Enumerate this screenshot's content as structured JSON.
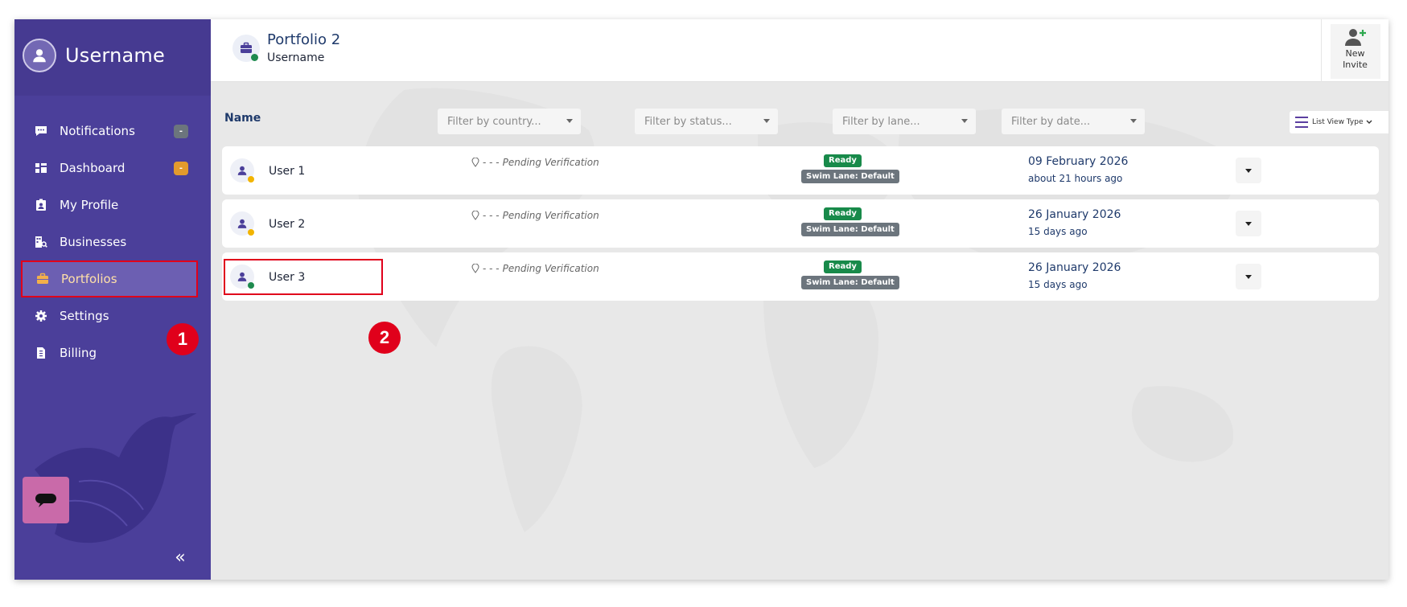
{
  "sidebar": {
    "username": "Username",
    "items": [
      {
        "label": "Notifications",
        "icon": "comment-dots-icon",
        "badge": "-",
        "badge_color": "#6c757d"
      },
      {
        "label": "Dashboard",
        "icon": "dashboard-icon",
        "badge": "-",
        "badge_color": "#e39a2d"
      },
      {
        "label": "My Profile",
        "icon": "id-badge-icon"
      },
      {
        "label": "Businesses",
        "icon": "building-search-icon"
      },
      {
        "label": "Portfolios",
        "icon": "briefcase-icon",
        "active": true
      },
      {
        "label": "Settings",
        "icon": "gear-icon"
      },
      {
        "label": "Billing",
        "icon": "invoice-icon"
      }
    ],
    "collapse_glyph": "«"
  },
  "header": {
    "title": "Portfolio 2",
    "subtitle": "Username",
    "new_invite_line1": "New",
    "new_invite_line2": "Invite"
  },
  "list": {
    "name_header": "Name",
    "filters": {
      "country": "Filter by country...",
      "status": "Filter by status...",
      "lane": "Filter by lane...",
      "date": "Filter by date..."
    },
    "view_type": "List View Type",
    "rows": [
      {
        "name": "User 1",
        "status_color": "#f2b400",
        "location_dashes": "- - -",
        "location": "Pending Verification",
        "status": "Ready",
        "lane": "Swim Lane: Default",
        "date": "09 February 2026",
        "ago": "about 21 hours ago"
      },
      {
        "name": "User 2",
        "status_color": "#f2b400",
        "location_dashes": "- - -",
        "location": "Pending Verification",
        "status": "Ready",
        "lane": "Swim Lane: Default",
        "date": "26 January 2026",
        "ago": "15 days ago"
      },
      {
        "name": "User 3",
        "status_color": "#1e8a4e",
        "location_dashes": "- - -",
        "location": "Pending Verification",
        "status": "Ready",
        "lane": "Swim Lane: Default",
        "date": "26 January 2026",
        "ago": "15 days ago"
      }
    ]
  },
  "annotations": {
    "step1": "1",
    "step2": "2"
  },
  "colors": {
    "sidebar_bg": "#4b3f9a",
    "ready_badge": "#188a4a",
    "lane_badge": "#6c757d",
    "highlight": "#e0001b"
  }
}
